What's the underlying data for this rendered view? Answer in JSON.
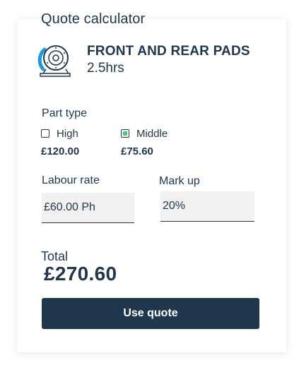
{
  "calculator": {
    "title": "Quote calculator"
  },
  "service": {
    "icon": "brake-disc-icon",
    "name": "FRONT AND REAR PADS",
    "duration": "2.5hrs"
  },
  "part_type": {
    "label": "Part type",
    "options": [
      {
        "label": "High",
        "price": "£120.00",
        "selected": false
      },
      {
        "label": "Middle",
        "price": "£75.60",
        "selected": true
      }
    ]
  },
  "labour": {
    "label": "Labour rate",
    "value": "£60.00 Ph"
  },
  "markup": {
    "label": "Mark up",
    "value": "20%"
  },
  "total": {
    "label": "Total",
    "value": "£270.60"
  },
  "actions": {
    "use_quote_label": "Use quote"
  },
  "colors": {
    "primary": "#1f364d",
    "accent_blue": "#1a9be0",
    "check_green": "#3ccf70",
    "input_bg": "#f1f1f1"
  }
}
